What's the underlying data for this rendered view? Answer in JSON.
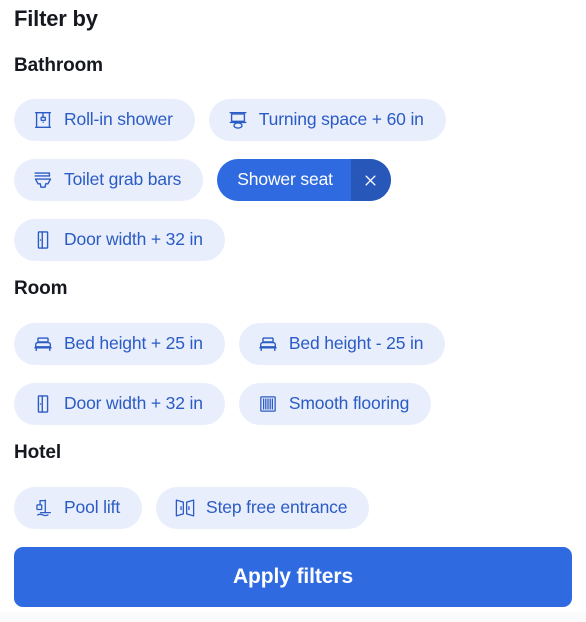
{
  "panel": {
    "title": "Filter by"
  },
  "sections": [
    {
      "id": "bathroom",
      "title": "Bathroom",
      "rows": [
        [
          {
            "icon": "roll-in-shower-icon",
            "label": "Roll-in shower",
            "selected": false
          },
          {
            "icon": "turning-space-icon",
            "label": "Turning space + 60 in",
            "selected": false
          }
        ],
        [
          {
            "icon": "toilet-grab-bars-icon",
            "label": "Toilet grab bars",
            "selected": false
          },
          {
            "icon": "none",
            "label": "Shower seat",
            "selected": true,
            "remove_label": "×"
          }
        ],
        [
          {
            "icon": "door-width-icon",
            "label": "Door width + 32 in",
            "selected": false
          }
        ]
      ]
    },
    {
      "id": "room",
      "title": "Room",
      "rows": [
        [
          {
            "icon": "bed-icon",
            "label": "Bed height + 25 in",
            "selected": false
          },
          {
            "icon": "bed-icon",
            "label": "Bed height - 25 in",
            "selected": false
          }
        ],
        [
          {
            "icon": "door-width-icon",
            "label": "Door width + 32 in",
            "selected": false
          },
          {
            "icon": "smooth-flooring-icon",
            "label": "Smooth flooring",
            "selected": false
          }
        ]
      ]
    },
    {
      "id": "hotel",
      "title": "Hotel",
      "rows": [
        [
          {
            "icon": "pool-lift-icon",
            "label": "Pool lift",
            "selected": false
          },
          {
            "icon": "step-free-entrance-icon",
            "label": "Step free entrance",
            "selected": false
          }
        ]
      ]
    }
  ],
  "apply": {
    "label": "Apply filters"
  },
  "colors": {
    "chip_background": "#e8eefc",
    "chip_text": "#2b5bc4",
    "selected_chip_background": "#2f6ae0",
    "selected_chip_remove_background": "#2757b8",
    "selected_chip_text": "#ffffff",
    "primary_button": "#2f6ae0",
    "heading_text": "#15181e"
  }
}
